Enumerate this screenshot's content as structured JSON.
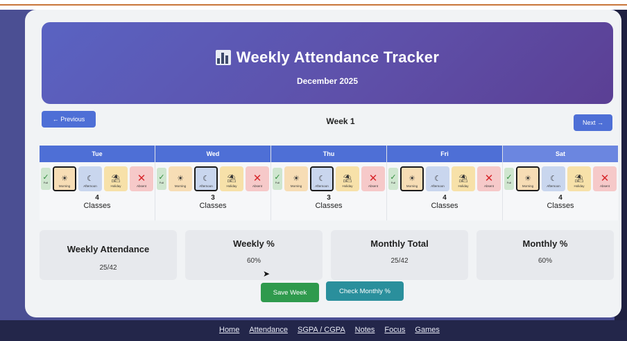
{
  "header": {
    "title": "Weekly Attendance Tracker",
    "subtitle": "December 2025",
    "title_icon": "bar-chart-icon"
  },
  "nav": {
    "previous_label": "← Previous",
    "next_label": "Next →",
    "week_label": "Week 1"
  },
  "days": [
    {
      "name": "Tue",
      "selected": "Morning",
      "count": "4",
      "classes_label": "Classes"
    },
    {
      "name": "Wed",
      "selected": "Afternoon",
      "count": "3",
      "classes_label": "Classes"
    },
    {
      "name": "Thu",
      "selected": "Afternoon",
      "count": "3",
      "classes_label": "Classes"
    },
    {
      "name": "Fri",
      "selected": "Morning",
      "count": "4",
      "classes_label": "Classes"
    },
    {
      "name": "Sat",
      "selected": "Morning",
      "count": "4",
      "classes_label": "Classes"
    }
  ],
  "options": {
    "full": "Full",
    "morning": "Morning",
    "afternoon": "Afternoon",
    "holiday": "Holiday",
    "absent": "Absent",
    "icons": {
      "full": "check-icon",
      "morning": "sun-icon",
      "afternoon": "moon-icon",
      "holiday": "beach-umbrella-icon",
      "absent": "cross-icon"
    }
  },
  "stats": [
    {
      "title": "Weekly Attendance",
      "value": "25/42"
    },
    {
      "title": "Weekly %",
      "value": "60%"
    },
    {
      "title": "Monthly Total",
      "value": "25/42"
    },
    {
      "title": "Monthly %",
      "value": "60%"
    }
  ],
  "actions": {
    "save_label": "Save Week",
    "check_label": "Check Monthly %"
  },
  "footer": {
    "links": [
      "Home",
      "Attendance",
      "SGPA / CGPA",
      "Notes",
      "Focus",
      "Games"
    ]
  },
  "colors": {
    "accent": "#4e6fd6",
    "header_start": "#5a63c2",
    "header_end": "#5b3f94",
    "save": "#2f9a4d",
    "check": "#2a8f9c"
  }
}
